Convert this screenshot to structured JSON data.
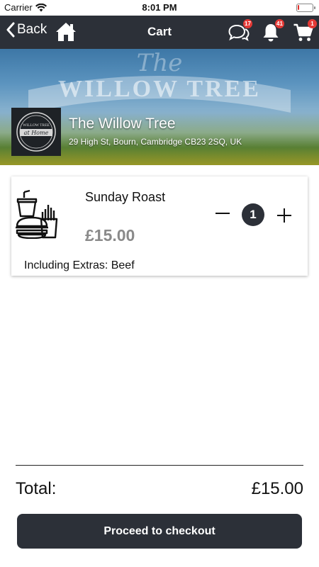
{
  "status_bar": {
    "carrier": "Carrier",
    "time": "8:01 PM",
    "battery_level": 0.1
  },
  "nav": {
    "back_label": "Back",
    "title": "Cart",
    "icons": {
      "back": "chevron-left-icon",
      "home": "home-icon",
      "chat": "chat-bubbles-icon",
      "notifications": "bell-icon",
      "cart": "cart-icon"
    },
    "chat_badge": "17",
    "notification_badge": "41",
    "cart_badge": "1"
  },
  "venue": {
    "name": "The Willow Tree",
    "address": "29 High St, Bourn, Cambridge CB23 2SQ, UK",
    "banner_brand": "WILLOW TREE",
    "banner_script": "The",
    "logo_top_text": "WILLOW TREE",
    "logo_script": "at Home"
  },
  "cart_items": [
    {
      "name": "Sunday Roast",
      "price": "£15.00",
      "quantity": "1",
      "extras": "Including Extras: Beef",
      "image_icon": "fast-food-icon"
    }
  ],
  "summary": {
    "total_label": "Total:",
    "total_value": "£15.00"
  },
  "checkout": {
    "label": "Proceed to checkout"
  },
  "colors": {
    "dark": "#2c3038",
    "badge": "#e53935",
    "price_gray": "#8a8a8a"
  }
}
